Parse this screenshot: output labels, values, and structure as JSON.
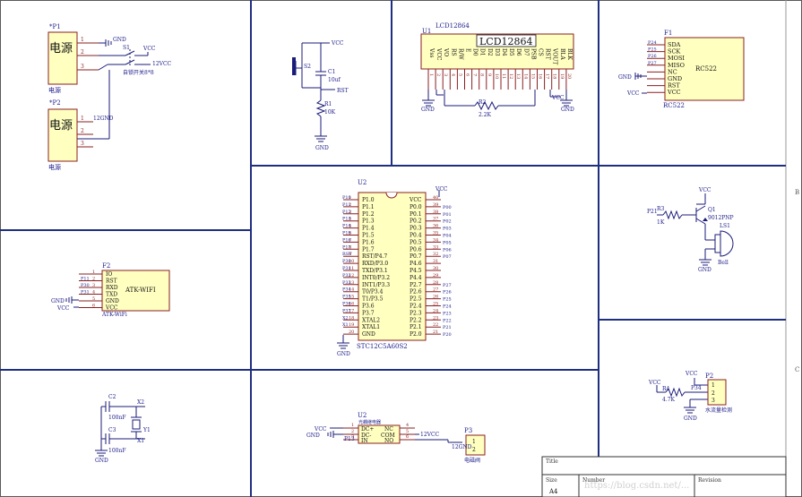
{
  "colors": {
    "background": "#ffffff",
    "sheet_border": "#5a5a5a",
    "divider": "#1f2f80",
    "wire": "#1b1b7a",
    "part_fill": "#ffffc0",
    "part_border": "#8a1f1f",
    "label": "#1b1b8a",
    "pin_label": "#8a1f1f",
    "ref": "#1b1b8a"
  },
  "border": {
    "zones": [
      "B",
      "C"
    ]
  },
  "p1": {
    "ref": "*P1",
    "title": "电源",
    "name": "电源",
    "pins": [
      "1",
      "2",
      "3"
    ]
  },
  "p2": {
    "ref": "*P2",
    "title": "电源",
    "name": "电源",
    "pins": [
      "1",
      "2",
      "3"
    ]
  },
  "s1": {
    "ref": "S1",
    "name": "自锁开关8*8",
    "net_gnd": "GND",
    "net_vcc": "VCC",
    "net_12v": "12VCC",
    "net_12gnd": "12GND"
  },
  "s2": {
    "ref": "S2"
  },
  "c1": {
    "ref": "C1",
    "value": "10uf"
  },
  "r1": {
    "ref": "R1",
    "value": "10K"
  },
  "reset_nets": {
    "vcc": "VCC",
    "rst": "RST",
    "gnd": "GND"
  },
  "u1": {
    "ref": "U1",
    "title": "LCD12864",
    "name": "LCD12864",
    "pins": [
      "Vss",
      "VCC",
      "VO",
      "RS",
      "R/W",
      "E",
      "D0",
      "D1",
      "D2",
      "D3",
      "D4",
      "D5",
      "D6",
      "D7",
      "PSB",
      "CS",
      "RST",
      "VOUT",
      "BLA",
      "BLK"
    ],
    "pin_numbers": [
      "1",
      "2",
      "3",
      "4",
      "5",
      "6",
      "7",
      "8",
      "9",
      "10",
      "11",
      "12",
      "13",
      "14",
      "15",
      "16",
      "17",
      "18",
      "19",
      "20"
    ],
    "gnd": "GND",
    "vcc": "VCC",
    "gnd2": "GND"
  },
  "r2": {
    "ref": "R2",
    "value": "2.2K"
  },
  "f1": {
    "ref": "F1",
    "title": "RC522",
    "name": "RC522",
    "pins": [
      "SDA",
      "SCK",
      "MOSI",
      "MISO",
      "NC",
      "GND",
      "RST",
      "VCC"
    ],
    "pin_nets": [
      "P24",
      "P25",
      "P26",
      "P27",
      "",
      "",
      "",
      ""
    ],
    "gnd": "GND",
    "vcc": "VCC"
  },
  "u2": {
    "ref": "U2",
    "name": "STC12C5A60S2",
    "left_pins": [
      "P1.0",
      "P1.1",
      "P1.2",
      "P1.3",
      "P1.4",
      "P1.5",
      "P1.6",
      "P1.7",
      "RST/P4.7",
      "RXD/P3.0",
      "TXD/P3.1",
      "INT0/P3.2",
      "INT1/P3.3",
      "T0/P3.4",
      "T1/P3.5",
      "P3.6",
      "P3.7",
      "XTAL2",
      "XTAL1",
      "GND"
    ],
    "left_nums": [
      "1",
      "2",
      "3",
      "4",
      "5",
      "6",
      "7",
      "8",
      "9",
      "10",
      "11",
      "12",
      "13",
      "14",
      "15",
      "16",
      "17",
      "18",
      "19",
      "20"
    ],
    "left_nets": [
      "P10",
      "P11",
      "P12",
      "P13",
      "P14",
      "P15",
      "P16",
      "P17",
      "RST",
      "P30",
      "P31",
      "P32",
      "P33",
      "P34",
      "P35",
      "P36",
      "P37",
      "X2",
      "X1",
      ""
    ],
    "right_pins": [
      "VCC",
      "P0.0",
      "P0.1",
      "P0.2",
      "P0.3",
      "P0.4",
      "P0.5",
      "P0.6",
      "P0.7",
      "P4.6",
      "P4.5",
      "P4.4",
      "P2.7",
      "P2.6",
      "P2.5",
      "P2.4",
      "P2.3",
      "P2.2",
      "P2.1",
      "P2.0"
    ],
    "right_nums": [
      "40",
      "39",
      "38",
      "37",
      "36",
      "35",
      "34",
      "33",
      "32",
      "31",
      "30",
      "29",
      "28",
      "27",
      "26",
      "25",
      "24",
      "23",
      "22",
      "21"
    ],
    "right_nets": [
      "",
      "P00",
      "P01",
      "P02",
      "P03",
      "P04",
      "P05",
      "P06",
      "P07",
      "",
      "",
      "",
      "P27",
      "P26",
      "P25",
      "P24",
      "P23",
      "P22",
      "P21",
      "P20"
    ],
    "vcc": "VCC",
    "gnd": "GND"
  },
  "f2": {
    "ref": "F2",
    "title": "ATK-WIFI",
    "name": "ATK-WiFi",
    "pins": [
      "IO",
      "RST",
      "RXD",
      "TXD",
      "GND",
      "VCC"
    ],
    "pin_nums": [
      "1",
      "2",
      "3",
      "4",
      "5",
      "6"
    ],
    "pin_nets": [
      "",
      "P11",
      "P30",
      "P31",
      "",
      ""
    ],
    "gnd": "GND",
    "vcc": "VCC"
  },
  "q1": {
    "ref": "Q1",
    "name": "9012PNP",
    "vcc": "VCC"
  },
  "r3": {
    "ref": "R3",
    "value": "1K",
    "net": "P21"
  },
  "ls1": {
    "ref": "LS1",
    "name": "Bell",
    "gnd": "GND"
  },
  "crystal": {
    "c2": "C2",
    "c2_value": "100nF",
    "c3": "C3",
    "c3_value": "100nF",
    "x2": "X2",
    "x1": "X1",
    "y1": "Y1",
    "gnd": "GND"
  },
  "relay": {
    "ref": "U2",
    "name": "光耦继电器",
    "pins": [
      "DC+",
      "DC-",
      "IN",
      "NC",
      "COM",
      "NO"
    ],
    "pin_nums": [
      "1",
      "2",
      "3",
      "4",
      "5",
      "6"
    ],
    "vcc": "VCC",
    "gnd": "GND",
    "in_net": "P13",
    "v12": "12VCC"
  },
  "p3": {
    "ref": "P3",
    "name": "电磁阀",
    "pins": [
      "1",
      "2"
    ],
    "net": "12GND"
  },
  "p2b": {
    "ref": "P2",
    "name": "水流量检测",
    "pins": [
      "1",
      "2",
      "3"
    ],
    "net": "P34",
    "vcc": "VCC",
    "gnd": "GND"
  },
  "r4": {
    "ref": "R4",
    "value": "4.7K",
    "vcc": "VCC"
  },
  "title_block": {
    "title_label": "Title",
    "size_label": "Size",
    "size_value": "A4",
    "number_label": "Number",
    "revision_label": "Revision",
    "watermark": "https://blog.csdn.net/..."
  }
}
